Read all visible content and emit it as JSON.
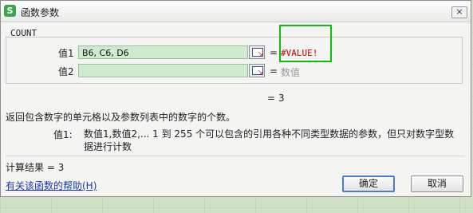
{
  "window": {
    "title": "函数参数",
    "app_icon": "S",
    "close_label": "×"
  },
  "function": {
    "name": "COUNT",
    "args": [
      {
        "label": "值1",
        "value": "B6, C6, D6",
        "equals": "=",
        "result": "#VALUE!"
      },
      {
        "label": "值2",
        "value": "",
        "equals": "=",
        "result": "数值"
      }
    ],
    "formula_result": "= 3",
    "description": "返回包含数字的单元格以及参数列表中的数字的个数。",
    "param_name": "值1:",
    "param_description": "数值1,数值2,... 1 到 255 个可以包含的引用各种不同类型数据的参数，但只对数字型数据进行计数"
  },
  "footer": {
    "calc_result": "计算结果 = 3",
    "help_link": "有关该函数的帮助(H)",
    "ok_label": "确定",
    "cancel_label": "取消"
  },
  "colors": {
    "input_bg": "#cdeccf",
    "error": "#c00000",
    "highlight_box": "#13b913",
    "link": "#1a3ba8"
  }
}
